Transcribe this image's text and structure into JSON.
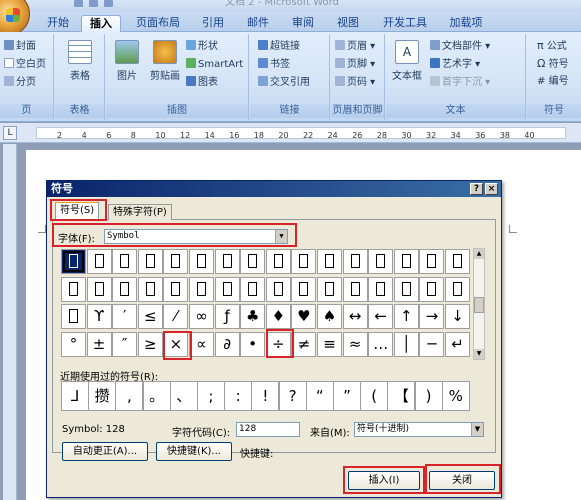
{
  "window": {
    "title": "文档 2 - Microsoft Word"
  },
  "ribbon_tabs": [
    "开始",
    "插入",
    "页面布局",
    "引用",
    "邮件",
    "审阅",
    "视图",
    "开发工具",
    "加载项"
  ],
  "ribbon_active_tab": "插入",
  "ribbon": {
    "pages": {
      "items": [
        "封面",
        "空白页",
        "分页"
      ],
      "label": "页"
    },
    "tables": {
      "button": "表格",
      "label": "表格"
    },
    "illustrations": {
      "picture": "图片",
      "clipart": "剪贴画",
      "shapes": "形状",
      "smartart": "SmartArt",
      "chart": "图表",
      "label": "插图"
    },
    "links": {
      "items": [
        "超链接",
        "书签",
        "交叉引用"
      ],
      "label": "链接"
    },
    "header_footer": {
      "items": [
        "页眉",
        "页脚",
        "页码"
      ],
      "label": "页眉和页脚"
    },
    "text": {
      "textbox": "文本框",
      "items": [
        "文档部件",
        "艺术字",
        "首字下沉"
      ],
      "label": "文本"
    },
    "symbols": {
      "items": [
        "公式",
        "符号",
        "编号"
      ],
      "label": "符号"
    }
  },
  "ruler": {
    "numbers": [
      "2",
      "4",
      "6",
      "8",
      "10",
      "12",
      "14",
      "16",
      "18",
      "20",
      "22",
      "24",
      "26",
      "28",
      "30",
      "32",
      "34",
      "36",
      "38",
      "40"
    ]
  },
  "dialog": {
    "title": "符号",
    "help_button": "?",
    "close_button": "×",
    "tabs": [
      "符号(S)",
      "特殊字符(P)"
    ],
    "font_label": "字体(F):",
    "font_value": "Symbol",
    "symbol_rows": [
      [
        "□",
        "□",
        "□",
        "□",
        "□",
        "□",
        "□",
        "□",
        "□",
        "□",
        "□",
        "□",
        "□",
        "□",
        "□",
        "□"
      ],
      [
        "□",
        "□",
        "□",
        "□",
        "□",
        "□",
        "□",
        "□",
        "□",
        "□",
        "□",
        "□",
        "□",
        "□",
        "□",
        "□"
      ],
      [
        "□",
        "ϒ",
        "′",
        "≤",
        "⁄",
        "∞",
        "ƒ",
        "♣",
        "♦",
        "♥",
        "♠",
        "↔",
        "←",
        "↑",
        "→",
        "↓"
      ],
      [
        "°",
        "±",
        "″",
        "≥",
        "×",
        "∝",
        "∂",
        "•",
        "÷",
        "≠",
        "≡",
        "≈",
        "…",
        "│",
        "─",
        "↵"
      ]
    ],
    "recent_label": "近期使用过的符号(R):",
    "recent_symbols": [
      "⅃",
      "攒",
      ",",
      "。",
      "、",
      ";",
      ":",
      "!",
      "?",
      "“",
      "”",
      "(",
      "【",
      ")",
      "%"
    ],
    "symbol_name": "Symbol: 128",
    "char_code_label": "字符代码(C):",
    "char_code_value": "128",
    "from_label": "来自(M):",
    "from_value": "符号(十进制)",
    "autocorrect_button": "自动更正(A)...",
    "shortcut_button": "快捷键(K)...",
    "shortcut_label": "快捷键:",
    "insert_button": "插入(I)",
    "close_text_button": "关闭"
  },
  "colors": {
    "highlight": "#d9232a",
    "dialog_title": "#0a246a",
    "ribbon": "#d4e3f6"
  }
}
